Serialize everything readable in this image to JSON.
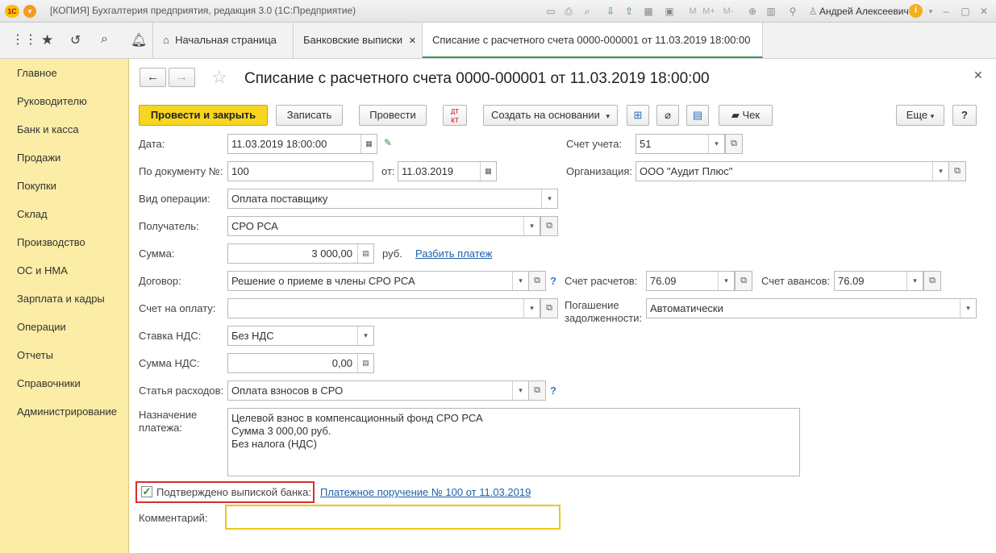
{
  "window": {
    "title": "[КОПИЯ] Бухгалтерия предприятия, редакция 3.0  (1С:Предприятие)",
    "user": "Андрей Алексеевич"
  },
  "tabs": [
    {
      "label": "Начальная страница"
    },
    {
      "label": "Банковские выписки"
    },
    {
      "label": "Списание с расчетного счета 0000-000001 от 11.03.2019 18:00:00"
    }
  ],
  "sidebar": {
    "items": [
      "Главное",
      "Руководителю",
      "Банк и касса",
      "Продажи",
      "Покупки",
      "Склад",
      "Производство",
      "ОС и НМА",
      "Зарплата и кадры",
      "Операции",
      "Отчеты",
      "Справочники",
      "Администрирование"
    ]
  },
  "doc": {
    "title": "Списание с расчетного счета 0000-000001 от 11.03.2019 18:00:00"
  },
  "toolbar": {
    "post_close": "Провести и закрыть",
    "save": "Записать",
    "post": "Провести",
    "create_based": "Создать на основании",
    "check": "Чек",
    "more": "Еще",
    "help": "?"
  },
  "form": {
    "date_label": "Дата:",
    "date": "11.03.2019 18:00:00",
    "docnum_label": "По документу №:",
    "docnum": "100",
    "from_label": "от:",
    "docdate": "11.03.2019",
    "account_label": "Счет учета:",
    "account": "51",
    "org_label": "Организация:",
    "org": "ООО \"Аудит Плюс\"",
    "optype_label": "Вид операции:",
    "optype": "Оплата поставщику",
    "recipient_label": "Получатель:",
    "recipient": "СРО РСА",
    "sum_label": "Сумма:",
    "sum": "3 000,00",
    "currency": "руб.",
    "split_link": "Разбить платеж",
    "contract_label": "Договор:",
    "contract": "Решение о приеме в члены СРО РСА",
    "settle_label": "Счет расчетов:",
    "settle": "76.09",
    "advance_label": "Счет авансов:",
    "advance": "76.09",
    "invoice_label": "Счет на оплату:",
    "invoice": "",
    "repay_label1": "Погашение",
    "repay_label2": "задолженности:",
    "repay": "Автоматически",
    "vat_rate_label": "Ставка НДС:",
    "vat_rate": "Без НДС",
    "vat_sum_label": "Сумма НДС:",
    "vat_sum": "0,00",
    "expense_label": "Статья расходов:",
    "expense": "Оплата взносов в СРО",
    "purpose_label1": "Назначение",
    "purpose_label2": "платежа:",
    "purpose_line1": "Целевой взнос в компенсационный фонд СРО РСА",
    "purpose_line2": "Сумма 3 000,00 руб.",
    "purpose_line3": "Без налога (НДС)",
    "confirmed_label": "Подтверждено выпиской банка:",
    "payment_link": "Платежное поручение № 100 от 11.03.2019",
    "comment_label": "Комментарий:",
    "comment": ""
  },
  "icons": {
    "dropdown": "▾",
    "open": "⧉",
    "calendar": "▦",
    "calculator": "▤",
    "help": "?"
  }
}
